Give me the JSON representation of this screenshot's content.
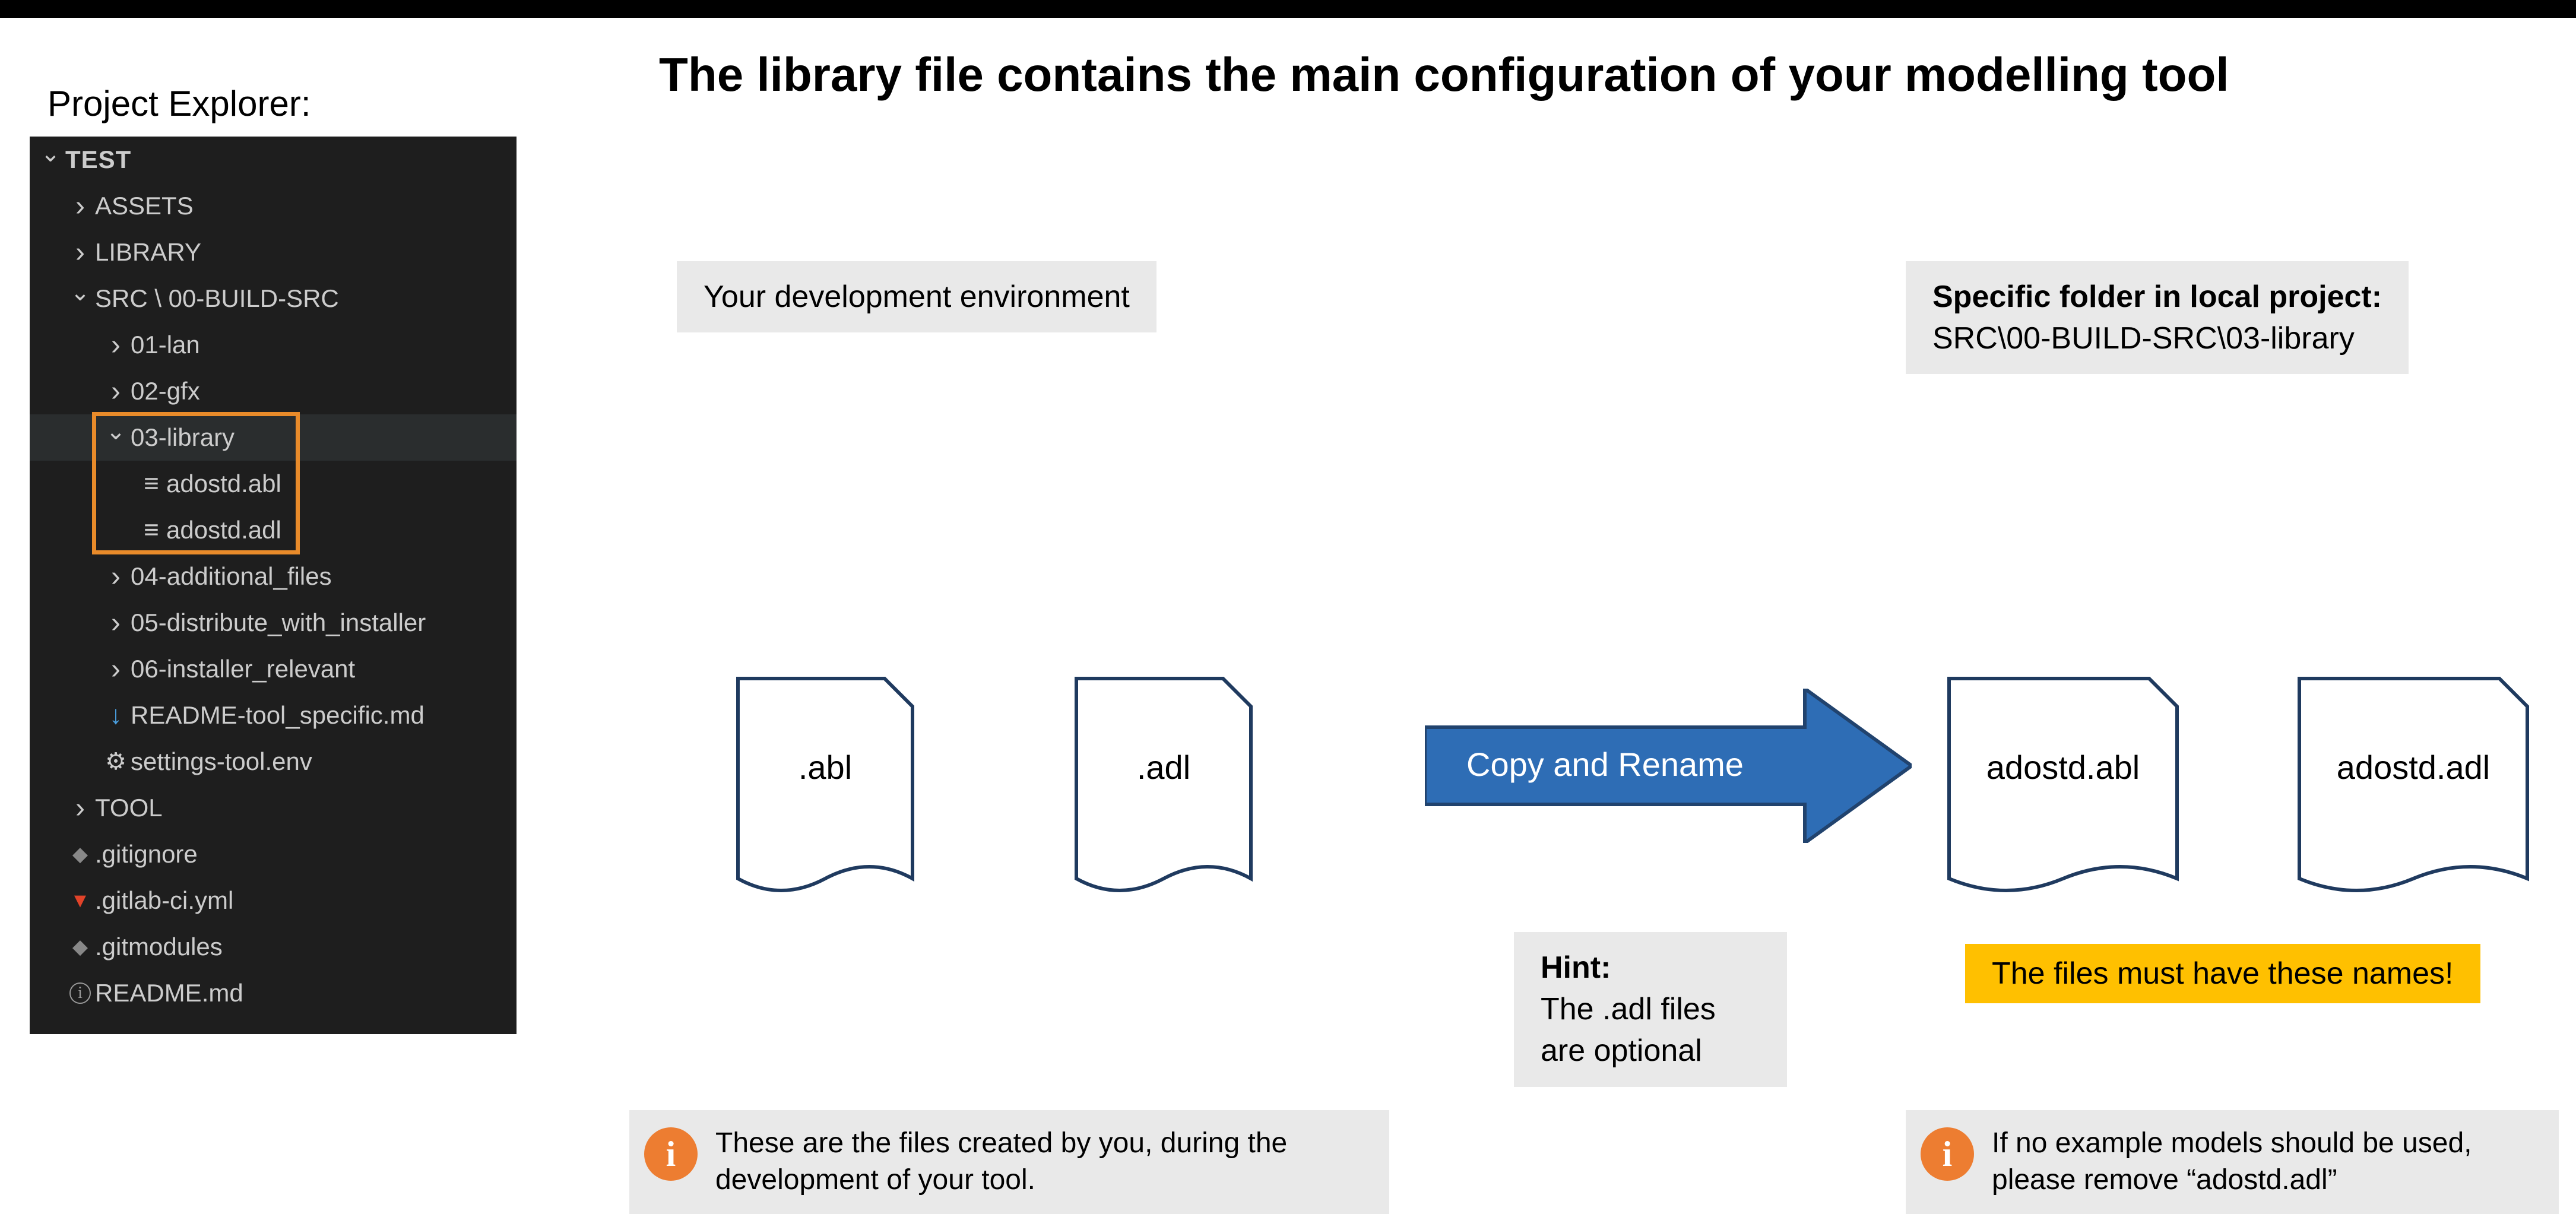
{
  "title": "The library file contains the main configuration of your modelling tool",
  "explorer_label": "Project Explorer:",
  "explorer": {
    "root": "TEST",
    "items": {
      "assets": "ASSETS",
      "library": "LIBRARY",
      "build_src": "SRC \\ 00-BUILD-SRC",
      "lan01": "01-lan",
      "gfx02": "02-gfx",
      "lib03": "03-library",
      "abl": "adostd.abl",
      "adl": "adostd.adl",
      "addl04": "04-additional_files",
      "dist05": "05-distribute_with_installer",
      "inst06": "06-installer_relevant",
      "readme_tool": "README-tool_specific.md",
      "settings": "settings-tool.env",
      "tool": "TOOL",
      "gitignore": ".gitignore",
      "gitlabci": ".gitlab-ci.yml",
      "gitmodules": ".gitmodules",
      "readme": "README.md"
    }
  },
  "devenv_label": "Your development environment",
  "folder_box": {
    "heading": "Specific folder in local project:",
    "path": "SRC\\00-BUILD-SRC\\03-library"
  },
  "files": {
    "src_abl": ".abl",
    "src_adl": ".adl",
    "dst_abl": "adostd.abl",
    "dst_adl": "adostd.adl"
  },
  "arrow_label": "Copy and Rename",
  "hint": {
    "heading": "Hint:",
    "body": "The .adl files are optional"
  },
  "names_warning": "The files must have these names!",
  "info_left": "These are the files created by you, during the development of your tool.",
  "info_right": "If no example models should be used, please remove “adostd.adl”"
}
